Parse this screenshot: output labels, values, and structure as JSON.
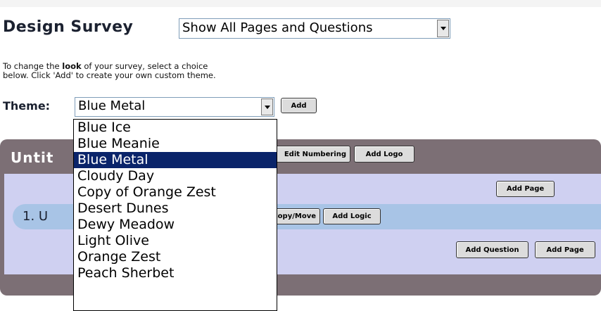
{
  "page": {
    "title": "Design Survey",
    "view_select": {
      "value": "Show All Pages and Questions"
    },
    "instructions": {
      "line1_pre": "To change the ",
      "line1_bold": "look",
      "line1_post": " of your survey, select a choice",
      "line2": "below.  Click 'Add' to create your own custom theme."
    },
    "theme_label": "Theme:",
    "theme_select": {
      "value": "Blue Metal"
    },
    "add_theme_button": "Add"
  },
  "survey": {
    "title_visible": "Untit",
    "toolbar": {
      "edit_numbering": "Edit Numbering",
      "add_logo": "Add Logo"
    },
    "add_page_top": "Add Page",
    "question": {
      "label_visible": "1. U",
      "copy_move": "Copy/Move",
      "add_logic": "Add Logic"
    },
    "add_question": "Add Question",
    "add_page_bottom": "Add Page"
  },
  "theme_dropdown": {
    "selected": "Blue Metal",
    "options": [
      "Blue Ice",
      "Blue Meanie",
      "Blue Metal",
      "Cloudy Day",
      "Copy of Orange Zest",
      "Desert Dunes",
      "Dewy Meadow",
      "Light Olive",
      "Orange Zest",
      "Peach Sherbet"
    ]
  },
  "colors": {
    "panel": "#7c6f75",
    "panel_inner": "#cfd0f1",
    "question_bar": "#a8c4e6",
    "selection": "#0a246a"
  }
}
